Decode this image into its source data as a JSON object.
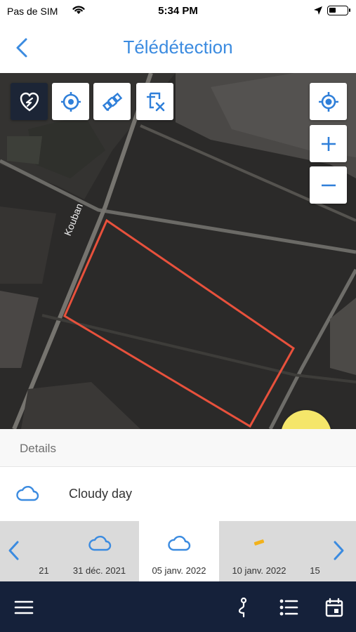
{
  "status_bar": {
    "carrier": "Pas de SIM",
    "time": "5:34 PM"
  },
  "nav": {
    "title": "Télédétection"
  },
  "map": {
    "road_label": "Kouban",
    "field_outline_color": "#e8513c",
    "buttons_left": [
      "field-select-icon",
      "target-icon",
      "satellite-icon",
      "clear-selection-icon"
    ],
    "buttons_right": [
      "locate-icon",
      "zoom-in-icon",
      "zoom-out-icon"
    ]
  },
  "details": {
    "header": "Details",
    "weather_icon": "cloud-icon",
    "weather_label": "Cloudy day"
  },
  "date_strip": {
    "items": [
      {
        "label": "21",
        "icon": ""
      },
      {
        "label": "31 déc. 2021",
        "icon": "cloud-icon"
      },
      {
        "label": "05 janv. 2022",
        "icon": "cloud-icon",
        "selected": true
      },
      {
        "label": "10 janv. 2022",
        "icon": "sun-icon"
      },
      {
        "label": "15",
        "icon": ""
      }
    ]
  },
  "bottom_bar": {
    "icons": [
      "menu-icon",
      "route-icon",
      "list-icon",
      "calendar-icon"
    ]
  },
  "colors": {
    "accent": "#3b8be0",
    "bottom_bar": "#15213a",
    "fab": "#f5e66a"
  }
}
